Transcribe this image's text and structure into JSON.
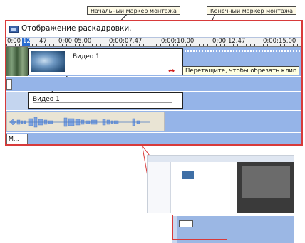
{
  "callouts": {
    "start_marker": "Начальный маркер монтажа",
    "end_marker": "Конечный маркер монтажа"
  },
  "storyboard": {
    "label": "Отображение раскадровки."
  },
  "ruler": {
    "time_labels": [
      "0:00",
      "12",
      "47",
      "0:00:05.00",
      "0:00:07.47",
      "0:00:10.00",
      "0:00:12.47",
      "0:00:15.00"
    ]
  },
  "video_clip": {
    "title": "Видео 1"
  },
  "trim_tooltip": "Перетащите, чтобы обрезать клип",
  "title_clip": {
    "label": "Видео 1"
  },
  "music_track": {
    "label": "М..."
  },
  "icons": [
    "storyboard-icon",
    "trim-cursor-icon",
    "audio-waveform-icon"
  ],
  "colors": {
    "frame": "#d83a3a",
    "track": "#95b4e8",
    "playhead": "#2a6cd0"
  }
}
